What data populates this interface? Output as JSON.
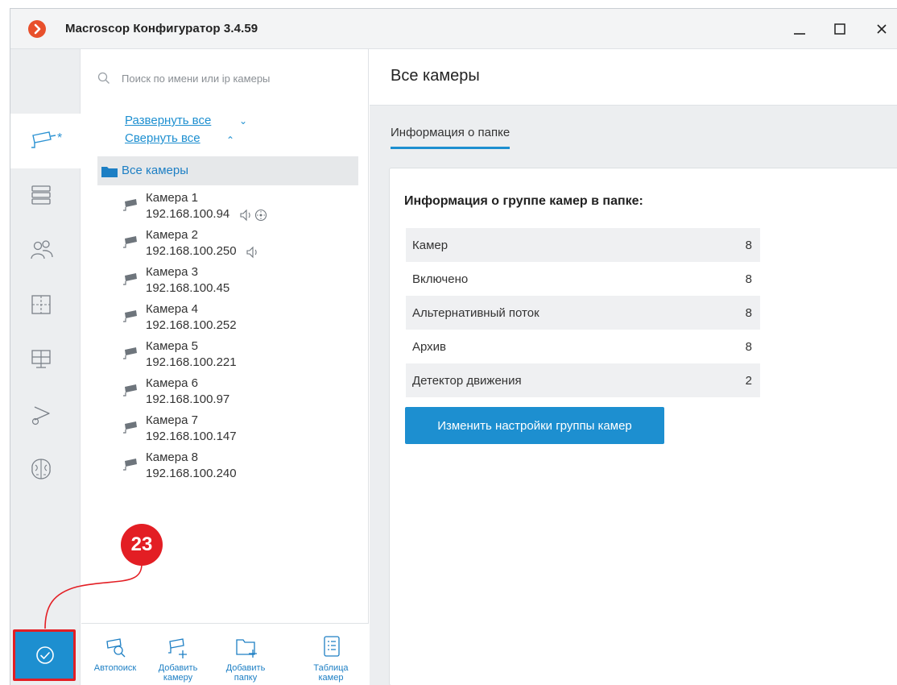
{
  "window": {
    "title": "Macroscop Конфигуратор 3.4.59"
  },
  "colors": {
    "accent": "#1d8fd0",
    "badge": "#e31e24",
    "logo": "#e8502c",
    "rail_bg": "#eceef0"
  },
  "rail": {
    "items": [
      {
        "icon": "camera-icon",
        "mark": "*",
        "active": true
      },
      {
        "icon": "server-icon"
      },
      {
        "icon": "users-icon"
      },
      {
        "icon": "layout-icon"
      },
      {
        "icon": "monitor-icon"
      },
      {
        "icon": "camera-settings-icon"
      },
      {
        "icon": "brain-icon"
      }
    ],
    "apply_icon": "check-circle-icon"
  },
  "callout": {
    "number": "23"
  },
  "tree": {
    "search_placeholder": "Поиск по имени или ip камеры",
    "expand_all": "Развернуть все",
    "collapse_all": "Свернуть все",
    "folder": "Все камеры",
    "cameras": [
      {
        "name": "Камера 1",
        "ip": "192.168.100.94",
        "audio": true,
        "ptz": true
      },
      {
        "name": "Камера 2",
        "ip": "192.168.100.250",
        "audio": true,
        "ptz": false
      },
      {
        "name": "Камера 3",
        "ip": "192.168.100.45"
      },
      {
        "name": "Камера 4",
        "ip": "192.168.100.252"
      },
      {
        "name": "Камера 5",
        "ip": "192.168.100.221"
      },
      {
        "name": "Камера 6",
        "ip": "192.168.100.97"
      },
      {
        "name": "Камера 7",
        "ip": "192.168.100.147"
      },
      {
        "name": "Камера 8",
        "ip": "192.168.100.240"
      }
    ],
    "toolbar": {
      "autosearch": "Автопоиск",
      "add_camera_1": "Добавить",
      "add_camera_2": "камеру",
      "add_folder_1": "Добавить",
      "add_folder_2": "папку",
      "camera_table_1": "Таблица",
      "camera_table_2": "камер"
    }
  },
  "main": {
    "title": "Все камеры",
    "tab": "Информация о папке",
    "card_title": "Информация о группе камер в папке:",
    "rows": [
      {
        "label": "Камер",
        "value": "8"
      },
      {
        "label": "Включено",
        "value": "8"
      },
      {
        "label": "Альтернативный поток",
        "value": "8"
      },
      {
        "label": "Архив",
        "value": "8"
      },
      {
        "label": "Детектор движения",
        "value": "2"
      }
    ],
    "change_button": "Изменить настройки группы камер"
  }
}
